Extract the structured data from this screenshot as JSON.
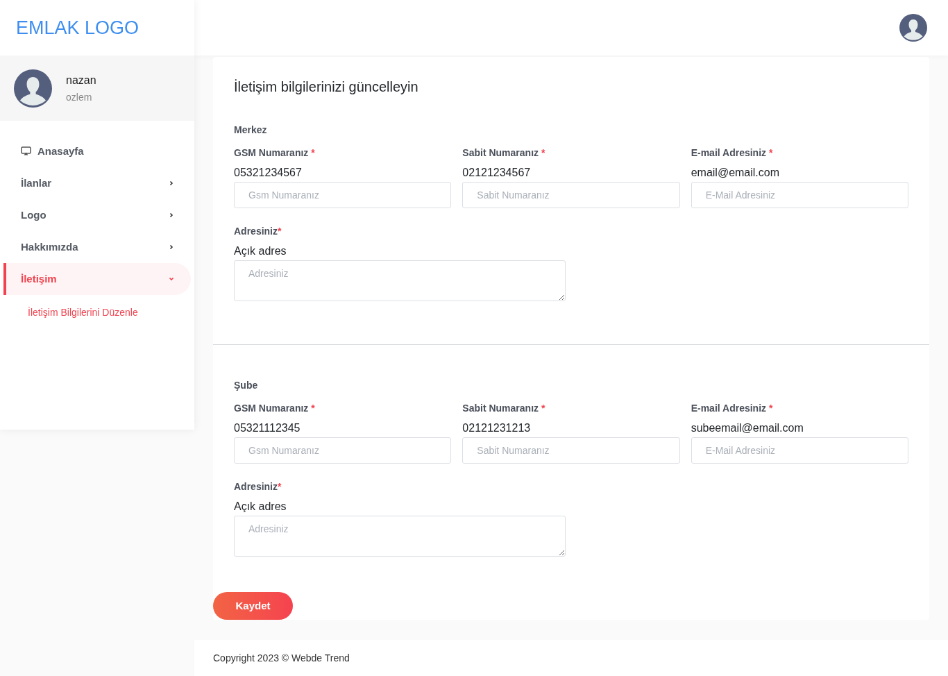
{
  "logo": "EMLAK LOGO",
  "user": {
    "name": "nazan",
    "subtitle": "ozlem"
  },
  "nav": [
    {
      "label": "Anasayfa",
      "kind": "home",
      "selected": false
    },
    {
      "label": "İlanlar",
      "kind": "group",
      "selected": false,
      "expanded": false
    },
    {
      "label": "Logo",
      "kind": "group",
      "selected": false,
      "expanded": false
    },
    {
      "label": "Hakkımızda",
      "kind": "group",
      "selected": false,
      "expanded": false
    },
    {
      "label": "İletişim",
      "kind": "group",
      "selected": true,
      "expanded": true,
      "children": [
        {
          "label": "İletişim Bilgilerini Düzenle",
          "selected": true
        }
      ]
    }
  ],
  "form": {
    "title": "İletişim bilgilerinizi güncelleyin",
    "sections": [
      {
        "heading": "Merkez",
        "fields": [
          {
            "label": "GSM Numaranız",
            "mark": "*",
            "value": "05321234567",
            "placeholder": "Gsm Numaranız"
          },
          {
            "label": "Sabit Numaranız",
            "mark": "*",
            "value": "02121234567",
            "placeholder": "Sabit Numaranız"
          },
          {
            "label": "E-mail Adresiniz",
            "mark": "*",
            "value": "email@email.com",
            "placeholder": "E-Mail Adresiniz"
          }
        ],
        "address": {
          "label": "Adresiniz",
          "mark": "*",
          "value": "Açık adres",
          "placeholder": "Adresiniz"
        }
      },
      {
        "heading": "Şube",
        "fields": [
          {
            "label": "GSM Numaranız",
            "mark": "*",
            "value": "05321112345",
            "placeholder": "Gsm Numaranız"
          },
          {
            "label": "Sabit Numaranız",
            "mark": "*",
            "value": "02121231213",
            "placeholder": "Sabit Numaranız"
          },
          {
            "label": "E-mail Adresiniz",
            "mark": "*",
            "value": "subeemail@email.com",
            "placeholder": "E-Mail Adresiniz"
          }
        ],
        "address": {
          "label": "Adresiniz",
          "mark": "*",
          "value": "Açık adres",
          "placeholder": "Adresiniz"
        }
      }
    ],
    "save_button": "Kaydet"
  },
  "footer": "Copyright 2023 © Webde Trend"
}
